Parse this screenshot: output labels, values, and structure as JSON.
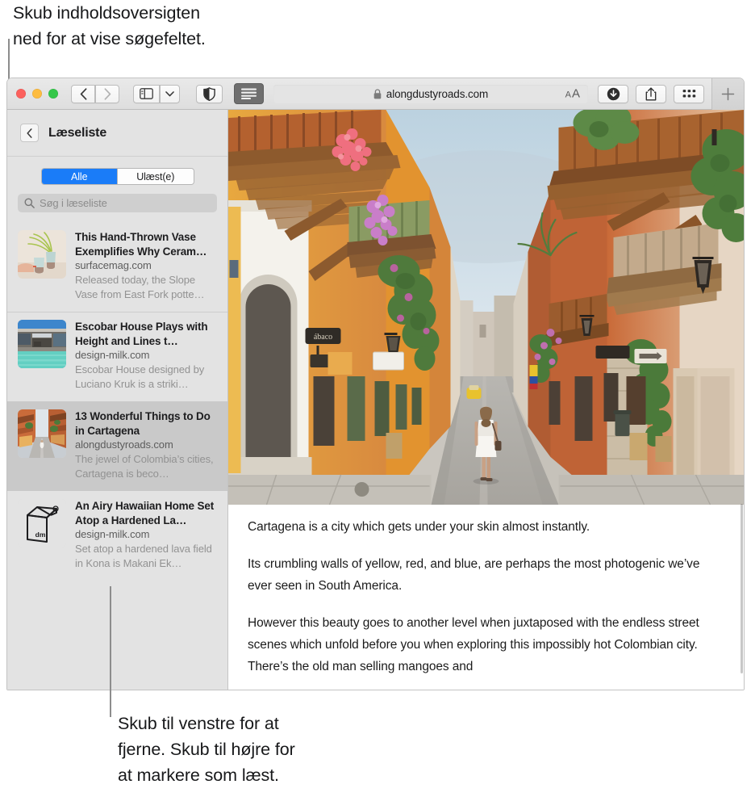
{
  "callouts": {
    "top": "Skub indholdsoversigten\nned for at vise søgefeltet.",
    "bottom": "Skub til venstre for at\nfjerne. Skub til højre for\nat markere som læst."
  },
  "toolbar": {
    "traffic_lights": [
      "close",
      "minimize",
      "zoom"
    ],
    "back_label": "Tilbage",
    "forward_label": "Frem",
    "sidebar_label": "Vis indholdsoversigt",
    "sidebar_menu_label": "Indholdsoversigt-menu",
    "shield_label": "Oversigt over privatlivsrapport",
    "reader_label": "Vis læser",
    "url": "alongdustyroads.com",
    "lock_icon": "lock-icon",
    "font_size_small": "A",
    "font_size_large": "A",
    "download_label": "Overførsler",
    "share_label": "Del",
    "tab_overview_label": "Taboversigt",
    "new_tab_label": "+"
  },
  "sidebar": {
    "back_icon": "chevron-left-icon",
    "title": "Læseliste",
    "segments": [
      {
        "label": "Alle",
        "active": true
      },
      {
        "label": "Ulæst(e)",
        "active": false
      }
    ],
    "search": {
      "icon": "search-icon",
      "placeholder": "Søg i læseliste",
      "value": ""
    },
    "items": [
      {
        "title": "This Hand-Thrown Vase Exemplifies Why Ceram…",
        "domain": "surfacemag.com",
        "excerpt": "Released today, the Slope Vase from East Fork potte…",
        "thumbnail": "ceramic-vases-thumbnail",
        "selected": false
      },
      {
        "title": "Escobar House Plays with Height and Lines t…",
        "domain": "design-milk.com",
        "excerpt": "Escobar House designed by Luciano Kruk is a striki…",
        "thumbnail": "modern-house-pool-thumbnail",
        "selected": false
      },
      {
        "title": "13 Wonderful Things to Do in Cartagena",
        "domain": "alongdustyroads.com",
        "excerpt": "The jewel of Colombia’s cities, Cartagena is beco…",
        "thumbnail": "cartagena-street-thumbnail",
        "selected": true
      },
      {
        "title": "An Airy Hawaiian Home Set Atop a Hardened La…",
        "domain": "design-milk.com",
        "excerpt": "Set atop a hardened lava field in Kona is Makani Ek…",
        "thumbnail": "design-milk-carton-logo",
        "selected": false
      }
    ]
  },
  "article": {
    "hero_alt": "cartagena-colonial-street-photo",
    "paragraphs": [
      "Cartagena is a city which gets under your skin almost instantly.",
      "Its crumbling walls of yellow, red, and blue, are perhaps the most photogenic we’ve ever seen in South America.",
      "However this beauty goes to another level when juxtaposed with the endless street scenes which unfold before you when exploring this impossibly hot Colombian city. There’s the old man selling mangoes and"
    ]
  },
  "colors": {
    "accent_blue": "#1a7cf8",
    "sidebar_bg": "#e3e3e3",
    "selected_row": "#c9c9c9",
    "toolbar_bg": "#e4e4e4",
    "reader_active": "#6f6f6f"
  }
}
